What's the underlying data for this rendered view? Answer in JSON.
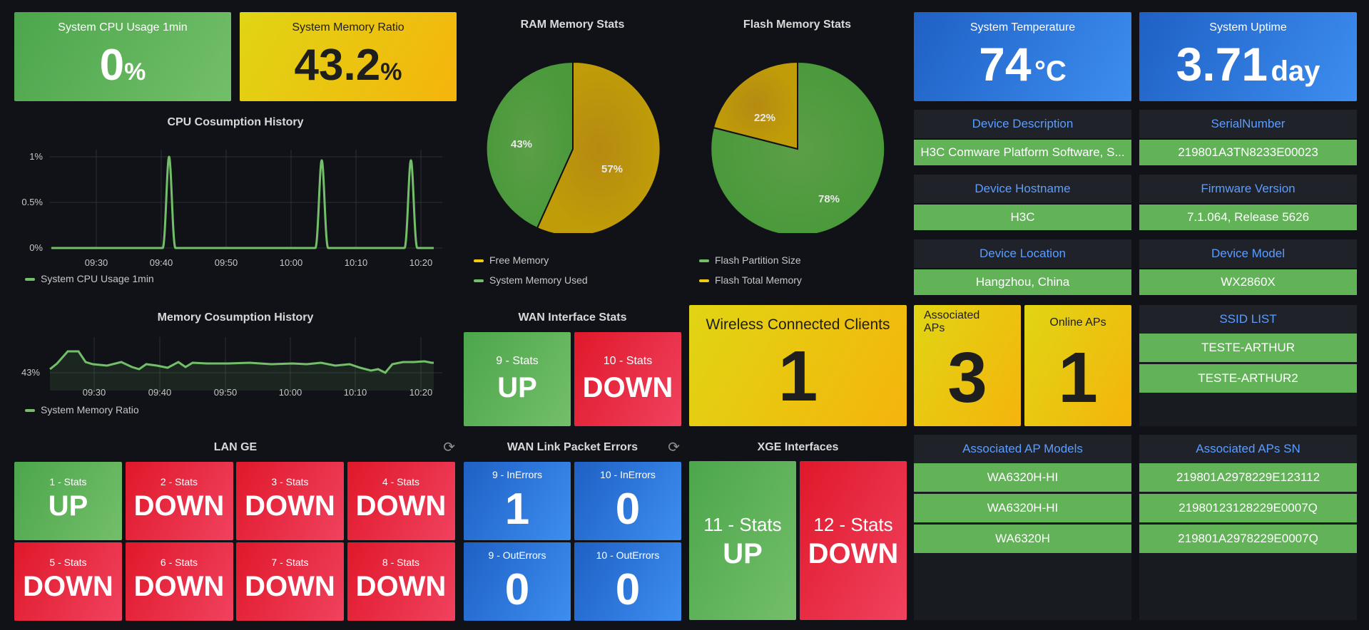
{
  "colors": {
    "green": "#73bf69",
    "yellow": "#f2cc0c",
    "red": "#f2495c",
    "blue": "#3274d9",
    "gold": "#b8860b"
  },
  "cpu_stat": {
    "title": "System CPU Usage 1min",
    "value": "0",
    "unit": "%"
  },
  "mem_stat": {
    "title": "System Memory Ratio",
    "value": "43.2",
    "unit": "%"
  },
  "ram_pie": {
    "title": "RAM Memory Stats",
    "free_pct": "57%",
    "used_pct": "43%",
    "legend_free": "Free Memory",
    "legend_used": "System Memory Used"
  },
  "flash_pie": {
    "title": "Flash Memory Stats",
    "partition_pct": "78%",
    "total_pct": "22%",
    "legend_partition": "Flash Partition Size",
    "legend_total": "Flash Total Memory"
  },
  "temp_stat": {
    "title": "System Temperature",
    "value": "74",
    "unit": "°C"
  },
  "uptime_stat": {
    "title": "System Uptime",
    "value": "3.71",
    "unit": "day"
  },
  "info": {
    "desc_label": "Device Description",
    "desc_value": "H3C Comware Platform Software, S...",
    "serial_label": "SerialNumber",
    "serial_value": "219801A3TN8233E00023",
    "host_label": "Device Hostname",
    "host_value": "H3C",
    "fw_label": "Firmware Version",
    "fw_value": "7.1.064, Release 5626",
    "loc_label": "Device Location",
    "loc_value": "Hangzhou, China",
    "model_label": "Device Model",
    "model_value": "WX2860X"
  },
  "cpu_history": {
    "title": "CPU Cosumption History",
    "y_ticks": [
      "1%",
      "0.5%",
      "0%"
    ],
    "x_ticks": [
      "09:30",
      "09:40",
      "09:50",
      "10:00",
      "10:10",
      "10:20"
    ],
    "legend": "System CPU Usage 1min"
  },
  "mem_history": {
    "title": "Memory Cosumption History",
    "y_ticks": [
      "43%"
    ],
    "x_ticks": [
      "09:30",
      "09:40",
      "09:50",
      "10:00",
      "10:10",
      "10:20"
    ],
    "legend": "System Memory Ratio"
  },
  "wan_stats": {
    "title": "WAN Interface Stats",
    "if9_label": "9 - Stats",
    "if9_value": "UP",
    "if10_label": "10 - Stats",
    "if10_value": "DOWN"
  },
  "wireless": {
    "title": "Wireless Connected Clients",
    "value": "1"
  },
  "assoc_aps": {
    "title": "Associated APs",
    "value": "3"
  },
  "online_aps": {
    "title": "Online APs",
    "value": "1"
  },
  "ssid": {
    "title": "SSID LIST",
    "items": [
      "TESTE-ARTHUR",
      "TESTE-ARTHUR2"
    ]
  },
  "lan_ge": {
    "title": "LAN GE",
    "ports": [
      {
        "label": "1 - Stats",
        "value": "UP"
      },
      {
        "label": "2 - Stats",
        "value": "DOWN"
      },
      {
        "label": "3 - Stats",
        "value": "DOWN"
      },
      {
        "label": "4 - Stats",
        "value": "DOWN"
      },
      {
        "label": "5 - Stats",
        "value": "DOWN"
      },
      {
        "label": "6 - Stats",
        "value": "DOWN"
      },
      {
        "label": "7 - Stats",
        "value": "DOWN"
      },
      {
        "label": "8 - Stats",
        "value": "DOWN"
      }
    ]
  },
  "wan_errors": {
    "title": "WAN Link Packet Errors",
    "items": [
      {
        "label": "9 - InErrors",
        "value": "1"
      },
      {
        "label": "10 - InErrors",
        "value": "0"
      },
      {
        "label": "9 - OutErrors",
        "value": "0"
      },
      {
        "label": "10 - OutErrors",
        "value": "0"
      }
    ]
  },
  "xge": {
    "title": "XGE Interfaces",
    "if11_label": "11 - Stats",
    "if11_value": "UP",
    "if12_label": "12 - Stats",
    "if12_value": "DOWN"
  },
  "ap_models": {
    "title": "Associated AP Models",
    "items": [
      "WA6320H-HI",
      "WA6320H-HI",
      "WA6320H"
    ]
  },
  "ap_sn": {
    "title": "Associated APs SN",
    "items": [
      "219801A2978229E123112",
      "21980123128229E0007Q",
      "219801A2978229E0007Q"
    ]
  }
}
